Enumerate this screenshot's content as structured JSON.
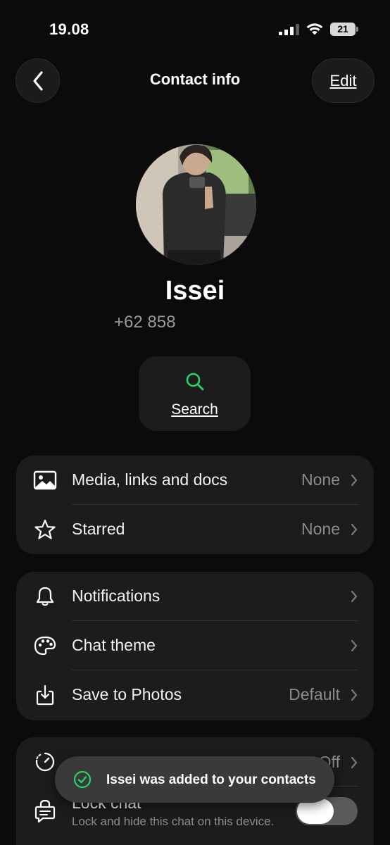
{
  "status_bar": {
    "time": "19.08",
    "battery": "21"
  },
  "nav": {
    "title": "Contact info",
    "edit_label": "Edit"
  },
  "contact": {
    "name": "Issei",
    "phone": "+62 858"
  },
  "search": {
    "label": "Search"
  },
  "media_card": {
    "rows": [
      {
        "label": "Media, links and docs",
        "value": "None",
        "icon": "image-icon"
      },
      {
        "label": "Starred",
        "value": "None",
        "icon": "star-icon"
      }
    ]
  },
  "settings_card": {
    "rows": [
      {
        "label": "Notifications",
        "value": "",
        "icon": "bell-icon"
      },
      {
        "label": "Chat theme",
        "value": "",
        "icon": "palette-icon"
      },
      {
        "label": "Save to Photos",
        "value": "Default",
        "icon": "save-download-icon"
      }
    ]
  },
  "privacy_card": {
    "disappearing_value": "Off",
    "lock_chat_label": "Lock chat",
    "lock_chat_sub": "Lock and hide this chat on this device.",
    "lock_chat_enabled": false
  },
  "toast": {
    "text": "Issei was added to your contacts"
  },
  "colors": {
    "accent_green": "#25d366",
    "background": "#0b0b0b",
    "card": "#1c1c1c"
  }
}
